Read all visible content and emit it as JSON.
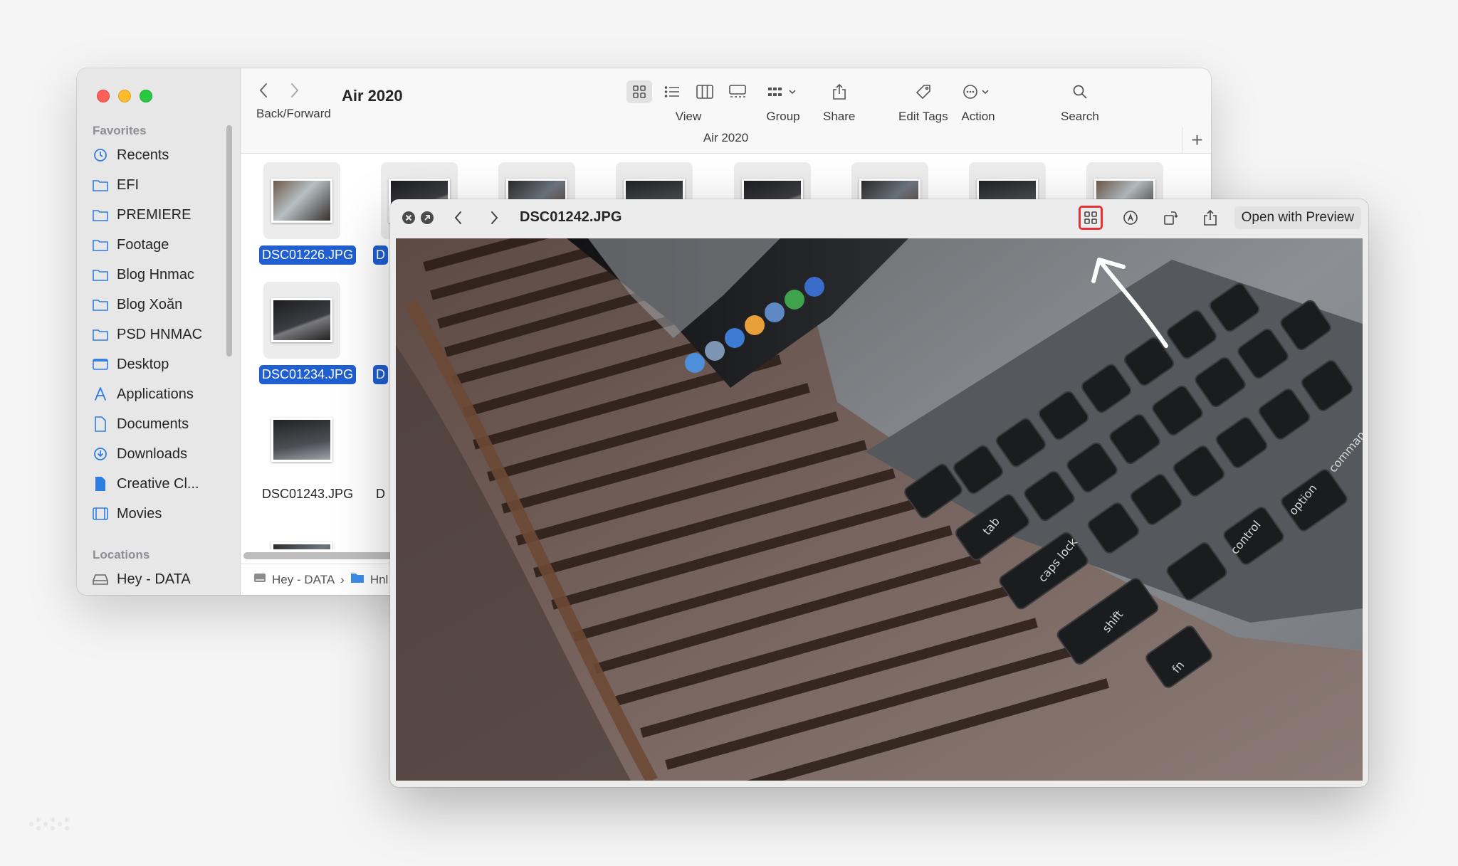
{
  "finder": {
    "title": "Air 2020",
    "nav_label": "Back/Forward",
    "path_title": "Air 2020",
    "toolbar": {
      "view_label": "View",
      "group_label": "Group",
      "share_label": "Share",
      "edit_tags_label": "Edit Tags",
      "action_label": "Action",
      "search_label": "Search"
    },
    "sidebar": {
      "favorites_header": "Favorites",
      "locations_header": "Locations",
      "items": [
        {
          "label": "Recents",
          "icon": "clock-icon"
        },
        {
          "label": "EFI",
          "icon": "folder-icon"
        },
        {
          "label": "PREMIERE",
          "icon": "folder-icon"
        },
        {
          "label": "Footage",
          "icon": "folder-icon"
        },
        {
          "label": "Blog Hnmac",
          "icon": "folder-icon"
        },
        {
          "label": "Blog Xoăn",
          "icon": "folder-icon"
        },
        {
          "label": "PSD HNMAC",
          "icon": "folder-icon"
        },
        {
          "label": "Desktop",
          "icon": "desktop-icon"
        },
        {
          "label": "Applications",
          "icon": "applications-icon"
        },
        {
          "label": "Documents",
          "icon": "document-icon"
        },
        {
          "label": "Downloads",
          "icon": "download-icon"
        },
        {
          "label": "Creative Cl...",
          "icon": "file-icon"
        },
        {
          "label": "Movies",
          "icon": "film-icon"
        }
      ],
      "locations": [
        {
          "label": "Hey - DATA",
          "icon": "disk-icon"
        }
      ]
    },
    "files": [
      {
        "name": "DSC01226.JPG",
        "selected": true
      },
      {
        "name": "D",
        "selected": true
      },
      {
        "name": "DSC01234.JPG",
        "selected": true
      },
      {
        "name": "D",
        "selected": true
      },
      {
        "name": "DSC01243.JPG",
        "selected": false
      },
      {
        "name": "D",
        "selected": false
      }
    ],
    "statusbar": {
      "disk": "Hey - DATA",
      "separator": "›",
      "folder": "Hnl"
    }
  },
  "quicklook": {
    "title": "DSC01242.JPG",
    "open_with_label": "Open with Preview",
    "keyboard_labels": [
      "tab",
      "caps lock",
      "shift",
      "control",
      "option",
      "command",
      "fn"
    ]
  },
  "colors": {
    "selection": "#1f5fd2",
    "highlight_box": "#e53238",
    "sidebar_icon": "#2f7de1"
  }
}
